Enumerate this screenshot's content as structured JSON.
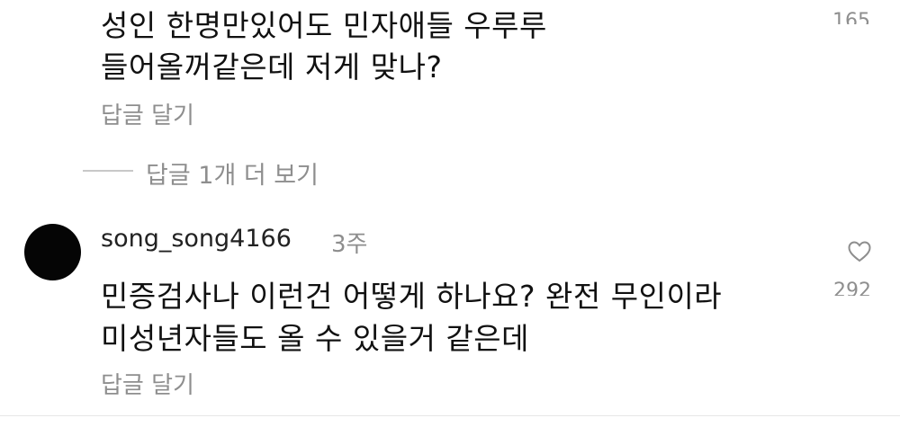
{
  "comments": [
    {
      "lines": [
        "성인 한명만있어도 민자애들 우루루",
        "들어올꺼같은데 저게 맞나?"
      ],
      "reply_label": "답글 달기",
      "like_count": "165",
      "more_replies_label": "답글 1개 더 보기"
    },
    {
      "username": "song_song4166",
      "time": "3주",
      "lines": [
        "민증검사나 이런건 어떻게 하나요? 완전 무인이라",
        "미성년자들도 올 수 있을거 같은데"
      ],
      "reply_label": "답글 달기",
      "like_count": "292"
    }
  ],
  "icons": {
    "like": "heart-outline-icon",
    "avatar": "profile-avatar"
  },
  "colors": {
    "text": "#111111",
    "secondary": "#8e8e8e",
    "avatar": "#050505"
  }
}
